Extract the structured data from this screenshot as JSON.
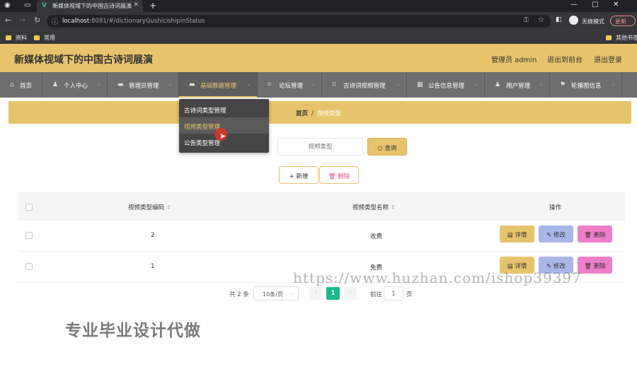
{
  "browser": {
    "tab_title": "新媒体视域下的中国古诗词展演",
    "url_host": "localhost",
    "url_path": ":8081/#/dictionaryGushicishipinStatus",
    "incognito_label": "无痕模式",
    "update_label": "更新",
    "bookmarks": [
      "资料",
      "常用"
    ],
    "bookmarks_right": "其他书签"
  },
  "header": {
    "title": "新媒体视域下的中国古诗词展演",
    "admin": "管理员 admin",
    "back_front": "退出到前台",
    "logout": "退出登录"
  },
  "nav": {
    "items": [
      {
        "label": "首页"
      },
      {
        "label": "个人中心"
      },
      {
        "label": "管理员管理"
      },
      {
        "label": "基础数据管理"
      },
      {
        "label": "论坛管理"
      },
      {
        "label": "古诗词视频管理"
      },
      {
        "label": "公告信息管理"
      },
      {
        "label": "用户管理"
      },
      {
        "label": "轮播图信息"
      }
    ],
    "active_index": 3
  },
  "dropdown": {
    "items": [
      "古诗词类型管理",
      "视频类型管理",
      "公告类型管理"
    ],
    "hover_index": 1
  },
  "breadcrumb": {
    "home": "首页",
    "separator": "/",
    "current": "视频类型"
  },
  "search": {
    "placeholder": "视频类型",
    "button": "查询"
  },
  "actions": {
    "add": "新增",
    "delete": "删除"
  },
  "table": {
    "columns": [
      "视频类型编码",
      "视频类型名称",
      "操作"
    ],
    "rows": [
      {
        "code": "2",
        "name": "收费"
      },
      {
        "code": "1",
        "name": "免费"
      }
    ],
    "row_actions": {
      "detail": "详情",
      "edit": "修改",
      "remove": "删除"
    }
  },
  "pagination": {
    "total": "共 2 条",
    "page_size": "10条/页",
    "current_page": "1",
    "goto_label": "前往",
    "goto_value": "1",
    "page_suffix": "页"
  },
  "watermarks": {
    "url": "https://www.huzhan.com/ishop39397",
    "ad": "专业毕业设计代做"
  },
  "colors": {
    "accent": "#e7c46c",
    "nav_bg": "#6e6e6e",
    "page_active": "#18b98a",
    "edit_btn": "#a8b7e8",
    "delete_btn": "#ee7ec9"
  }
}
